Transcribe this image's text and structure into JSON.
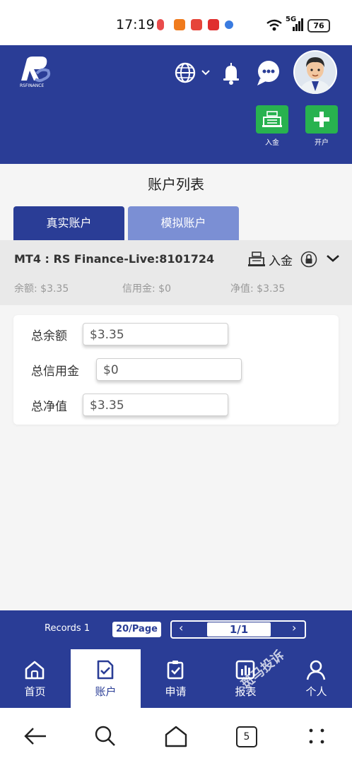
{
  "status_bar": {
    "time": "17:19",
    "network": "5G",
    "battery": "76"
  },
  "header": {
    "logo_text": "RSFINANCE",
    "quick_actions": [
      {
        "label": "入金"
      },
      {
        "label": "开户"
      }
    ]
  },
  "page": {
    "title": "账户列表"
  },
  "tabs": [
    {
      "label": "真实账户",
      "active": true
    },
    {
      "label": "模拟账户",
      "active": false
    }
  ],
  "account": {
    "name": "MT4 : RS Finance-Live:8101724",
    "deposit_label": "入金",
    "balance": "余额: $3.35",
    "credit": "信用金: $0",
    "equity": "净值: $3.35"
  },
  "summary": {
    "rows": [
      {
        "label": "总余额",
        "value": "$3.35"
      },
      {
        "label": "总信用金",
        "value": "$0"
      },
      {
        "label": "总净值",
        "value": "$3.35"
      }
    ]
  },
  "pager": {
    "records": "Records 1",
    "per_page": "20/Page",
    "page": "1/1"
  },
  "bottom_nav": [
    {
      "label": "首页",
      "active": false
    },
    {
      "label": "账户",
      "active": true
    },
    {
      "label": "申请",
      "active": false
    },
    {
      "label": "报表",
      "active": false
    },
    {
      "label": "个人",
      "active": false
    }
  ],
  "system_nav": {
    "tabs_count": "5"
  },
  "watermark": "斑马投诉",
  "colors": {
    "brand": "#2a3d96",
    "brand_light": "#7b8fd4",
    "action_green": "#28b24f"
  }
}
